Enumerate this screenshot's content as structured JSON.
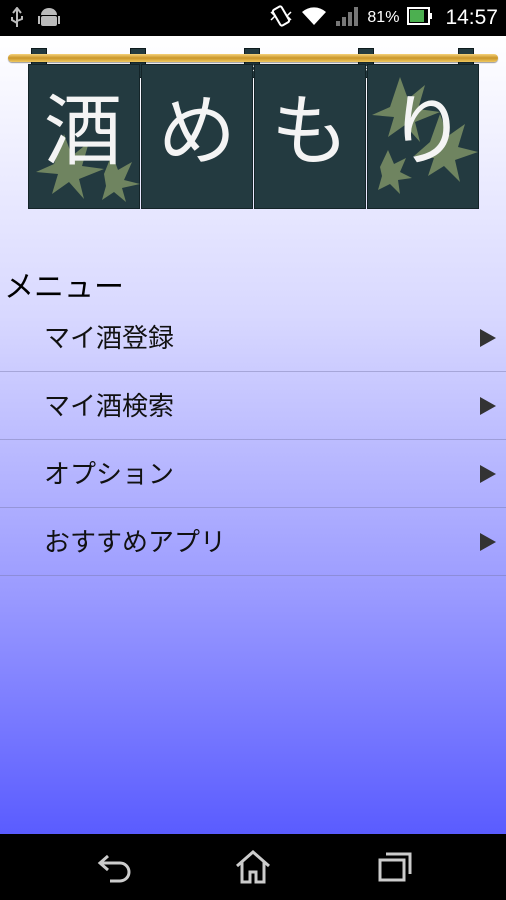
{
  "status_bar": {
    "battery_percent": "81%",
    "time": "14:57",
    "icons": [
      "usb-icon",
      "android-icon",
      "vibrate-icon",
      "wifi-icon",
      "signal-icon",
      "battery-icon"
    ]
  },
  "banner": {
    "kanji": [
      "酒",
      "め",
      "も",
      "り"
    ],
    "colors": {
      "cloth": "#233a40",
      "rod": "#d4a33a",
      "leaf": "#7d9166"
    }
  },
  "menu": {
    "heading": "メニュー",
    "items": [
      {
        "label": "マイ酒登録"
      },
      {
        "label": "マイ酒検索"
      },
      {
        "label": "オプション"
      },
      {
        "label": "おすすめアプリ"
      }
    ]
  },
  "nav_bar": {
    "buttons": [
      "back-icon",
      "home-icon",
      "recent-apps-icon"
    ]
  }
}
